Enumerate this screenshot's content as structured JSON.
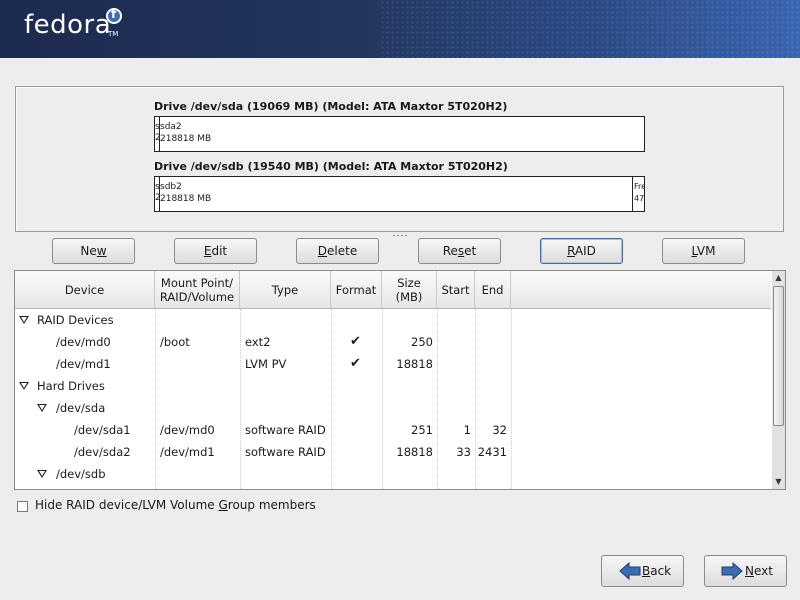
{
  "banner": {
    "logo_text": "fedora",
    "tm": "TM",
    "colors": {
      "dark": "#1d2a4f",
      "light": "#3a64b0"
    }
  },
  "drives": [
    {
      "title": "Drive /dev/sda (19069 MB) (Model: ATA Maxtor 5T020H2)",
      "tiny_label": "s",
      "main_name": "sda2",
      "main_size": "218818 MB",
      "tiny_size": "2"
    },
    {
      "title": "Drive /dev/sdb (19540 MB) (Model: ATA Maxtor 5T020H2)",
      "tiny_label": "s",
      "main_name": "sdb2",
      "main_size": "218818 MB",
      "tiny_size": "2",
      "free_label": "Fre",
      "free_size": "47"
    }
  ],
  "buttons": {
    "new": {
      "pre": "Ne",
      "key": "w",
      "post": ""
    },
    "edit": {
      "pre": "",
      "key": "E",
      "post": "dit"
    },
    "delete": {
      "pre": "",
      "key": "D",
      "post": "elete"
    },
    "reset": {
      "pre": "Re",
      "key": "s",
      "post": "et"
    },
    "raid": {
      "pre": "",
      "key": "R",
      "post": "AID"
    },
    "lvm": {
      "pre": "",
      "key": "L",
      "post": "VM"
    }
  },
  "table": {
    "headers": {
      "device": "Device",
      "mount1": "Mount Point/",
      "mount2": "RAID/Volume",
      "type": "Type",
      "format": "Format",
      "size1": "Size",
      "size2": "(MB)",
      "start": "Start",
      "end": "End"
    },
    "rows": [
      {
        "device": "RAID Devices",
        "mount": "",
        "type": "",
        "format": "",
        "size": "",
        "start": "",
        "end": ""
      },
      {
        "device": "/dev/md0",
        "mount": "/boot",
        "type": "ext2",
        "format": "✔",
        "size": "250",
        "start": "",
        "end": ""
      },
      {
        "device": "/dev/md1",
        "mount": "",
        "type": "LVM PV",
        "format": "✔",
        "size": "18818",
        "start": "",
        "end": ""
      },
      {
        "device": "Hard Drives",
        "mount": "",
        "type": "",
        "format": "",
        "size": "",
        "start": "",
        "end": ""
      },
      {
        "device": "/dev/sda",
        "mount": "",
        "type": "",
        "format": "",
        "size": "",
        "start": "",
        "end": ""
      },
      {
        "device": "/dev/sda1",
        "mount": "/dev/md0",
        "type": "software RAID",
        "format": "",
        "size": "251",
        "start": "1",
        "end": "32"
      },
      {
        "device": "/dev/sda2",
        "mount": "/dev/md1",
        "type": "software RAID",
        "format": "",
        "size": "18818",
        "start": "33",
        "end": "2431"
      },
      {
        "device": "/dev/sdb",
        "mount": "",
        "type": "",
        "format": "",
        "size": "",
        "start": "",
        "end": ""
      }
    ]
  },
  "hide_checkbox": {
    "pre": "Hide RAID device/LVM Volume ",
    "key": "G",
    "post": "roup members",
    "checked": false
  },
  "nav": {
    "back": {
      "pre": "",
      "key": "B",
      "post": "ack"
    },
    "next": {
      "pre": "",
      "key": "N",
      "post": "ext"
    }
  }
}
